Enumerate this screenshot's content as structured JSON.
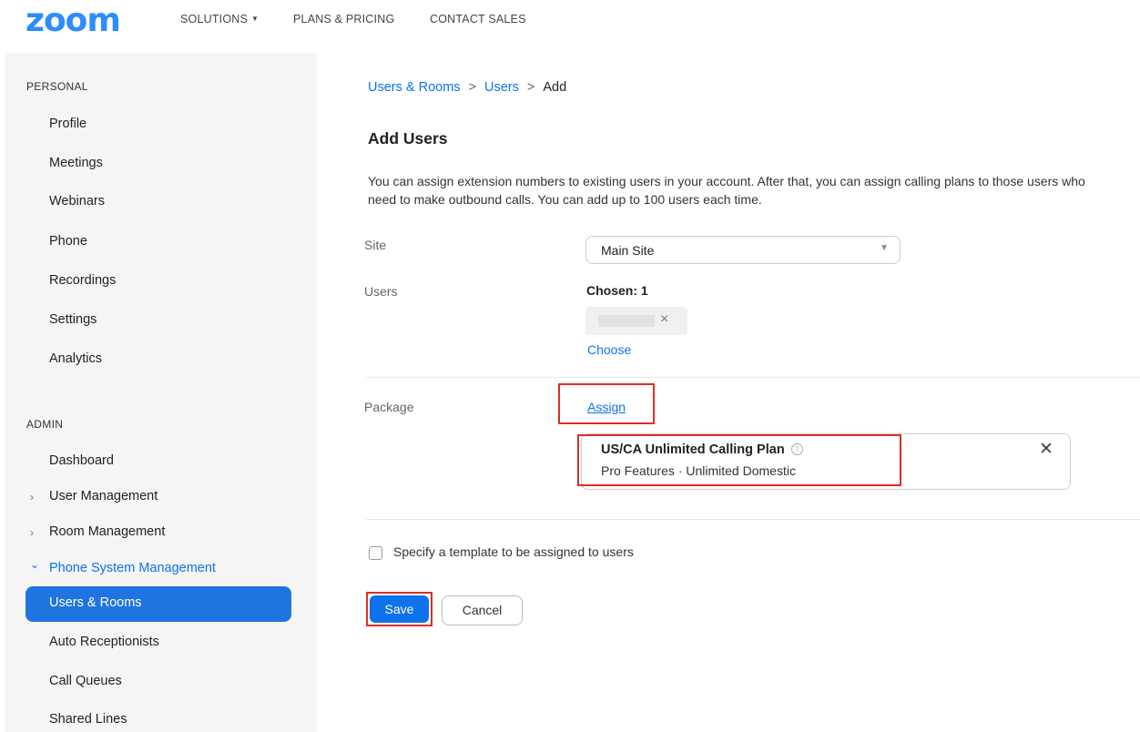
{
  "header": {
    "logo": "zoom",
    "nav": [
      {
        "label": "SOLUTIONS",
        "has_dropdown": true
      },
      {
        "label": "PLANS & PRICING"
      },
      {
        "label": "CONTACT SALES"
      }
    ]
  },
  "sidebar": {
    "personal_heading": "PERSONAL",
    "personal_items": [
      "Profile",
      "Meetings",
      "Webinars",
      "Phone",
      "Recordings",
      "Settings",
      "Analytics"
    ],
    "admin_heading": "ADMIN",
    "admin_items": [
      {
        "label": "Dashboard"
      },
      {
        "label": "User Management",
        "arrow": "›"
      },
      {
        "label": "Room Management",
        "arrow": "›"
      },
      {
        "label": "Phone System Management",
        "arrow": "⌄",
        "expanded": true
      }
    ],
    "phone_subitems": [
      {
        "label": "Users & Rooms",
        "active": true
      },
      {
        "label": "Auto Receptionists"
      },
      {
        "label": "Call Queues"
      },
      {
        "label": "Shared Lines"
      }
    ]
  },
  "main": {
    "breadcrumb": [
      "Users & Rooms",
      "Users",
      "Add"
    ],
    "breadcrumb_sep": ">",
    "title": "Add Users",
    "description": "You can assign extension numbers to existing users in your account. After that, you can assign calling plans to those users who need to make outbound calls. You can add up to 100 users each time.",
    "site": {
      "label": "Site",
      "value": "Main Site"
    },
    "users": {
      "label": "Users",
      "chosen_text": "Chosen: 1",
      "choose_link": "Choose"
    },
    "package": {
      "label": "Package",
      "assign_link": "Assign",
      "plan_name": "US/CA Unlimited Calling Plan",
      "plan_details": "Pro Features · Unlimited Domestic"
    },
    "template_checkbox": {
      "label": "Specify a template to be assigned to users",
      "checked": false
    },
    "buttons": {
      "save": "Save",
      "cancel": "Cancel"
    }
  },
  "colors": {
    "brand": "#2D8CFF",
    "link": "#0E72ED",
    "active_bg": "#1F74E0",
    "highlight": "#D93025"
  }
}
